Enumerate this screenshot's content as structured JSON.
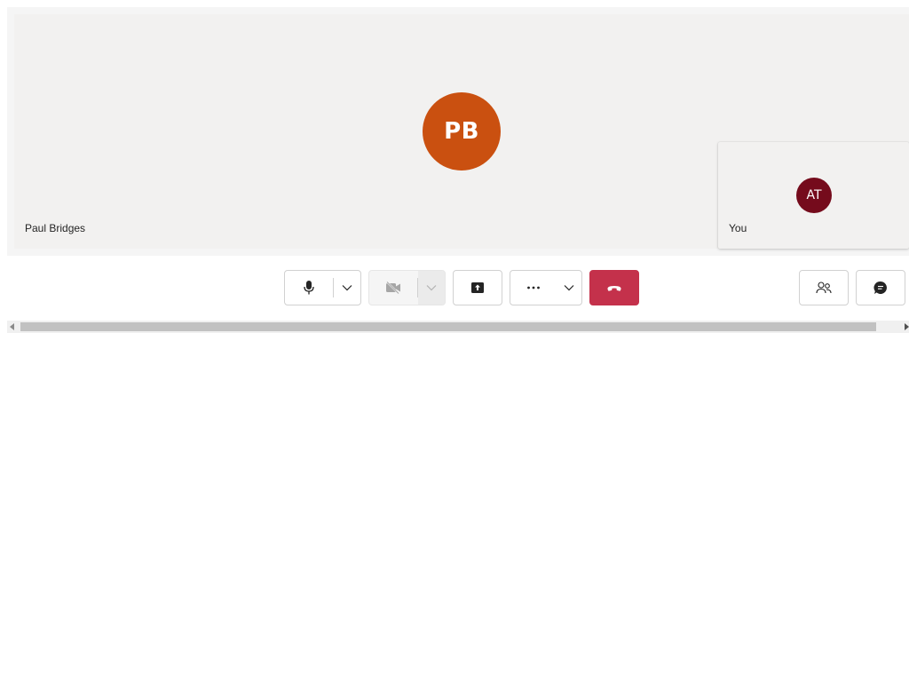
{
  "participants": {
    "main": {
      "name": "Paul Bridges",
      "initials": "PB",
      "color": "#ca5010"
    },
    "self": {
      "name": "You",
      "initials": "AT",
      "color": "#750b1c"
    }
  },
  "toolbar": {
    "mic_icon": "microphone-icon",
    "camera_icon": "video-off-icon",
    "camera_disabled": true,
    "share_icon": "share-screen-icon",
    "more_icon": "more-actions-icon",
    "leave_icon": "hang-up-icon",
    "leave_color": "#c4314b",
    "people_icon": "people-icon",
    "chat_icon": "chat-icon"
  }
}
